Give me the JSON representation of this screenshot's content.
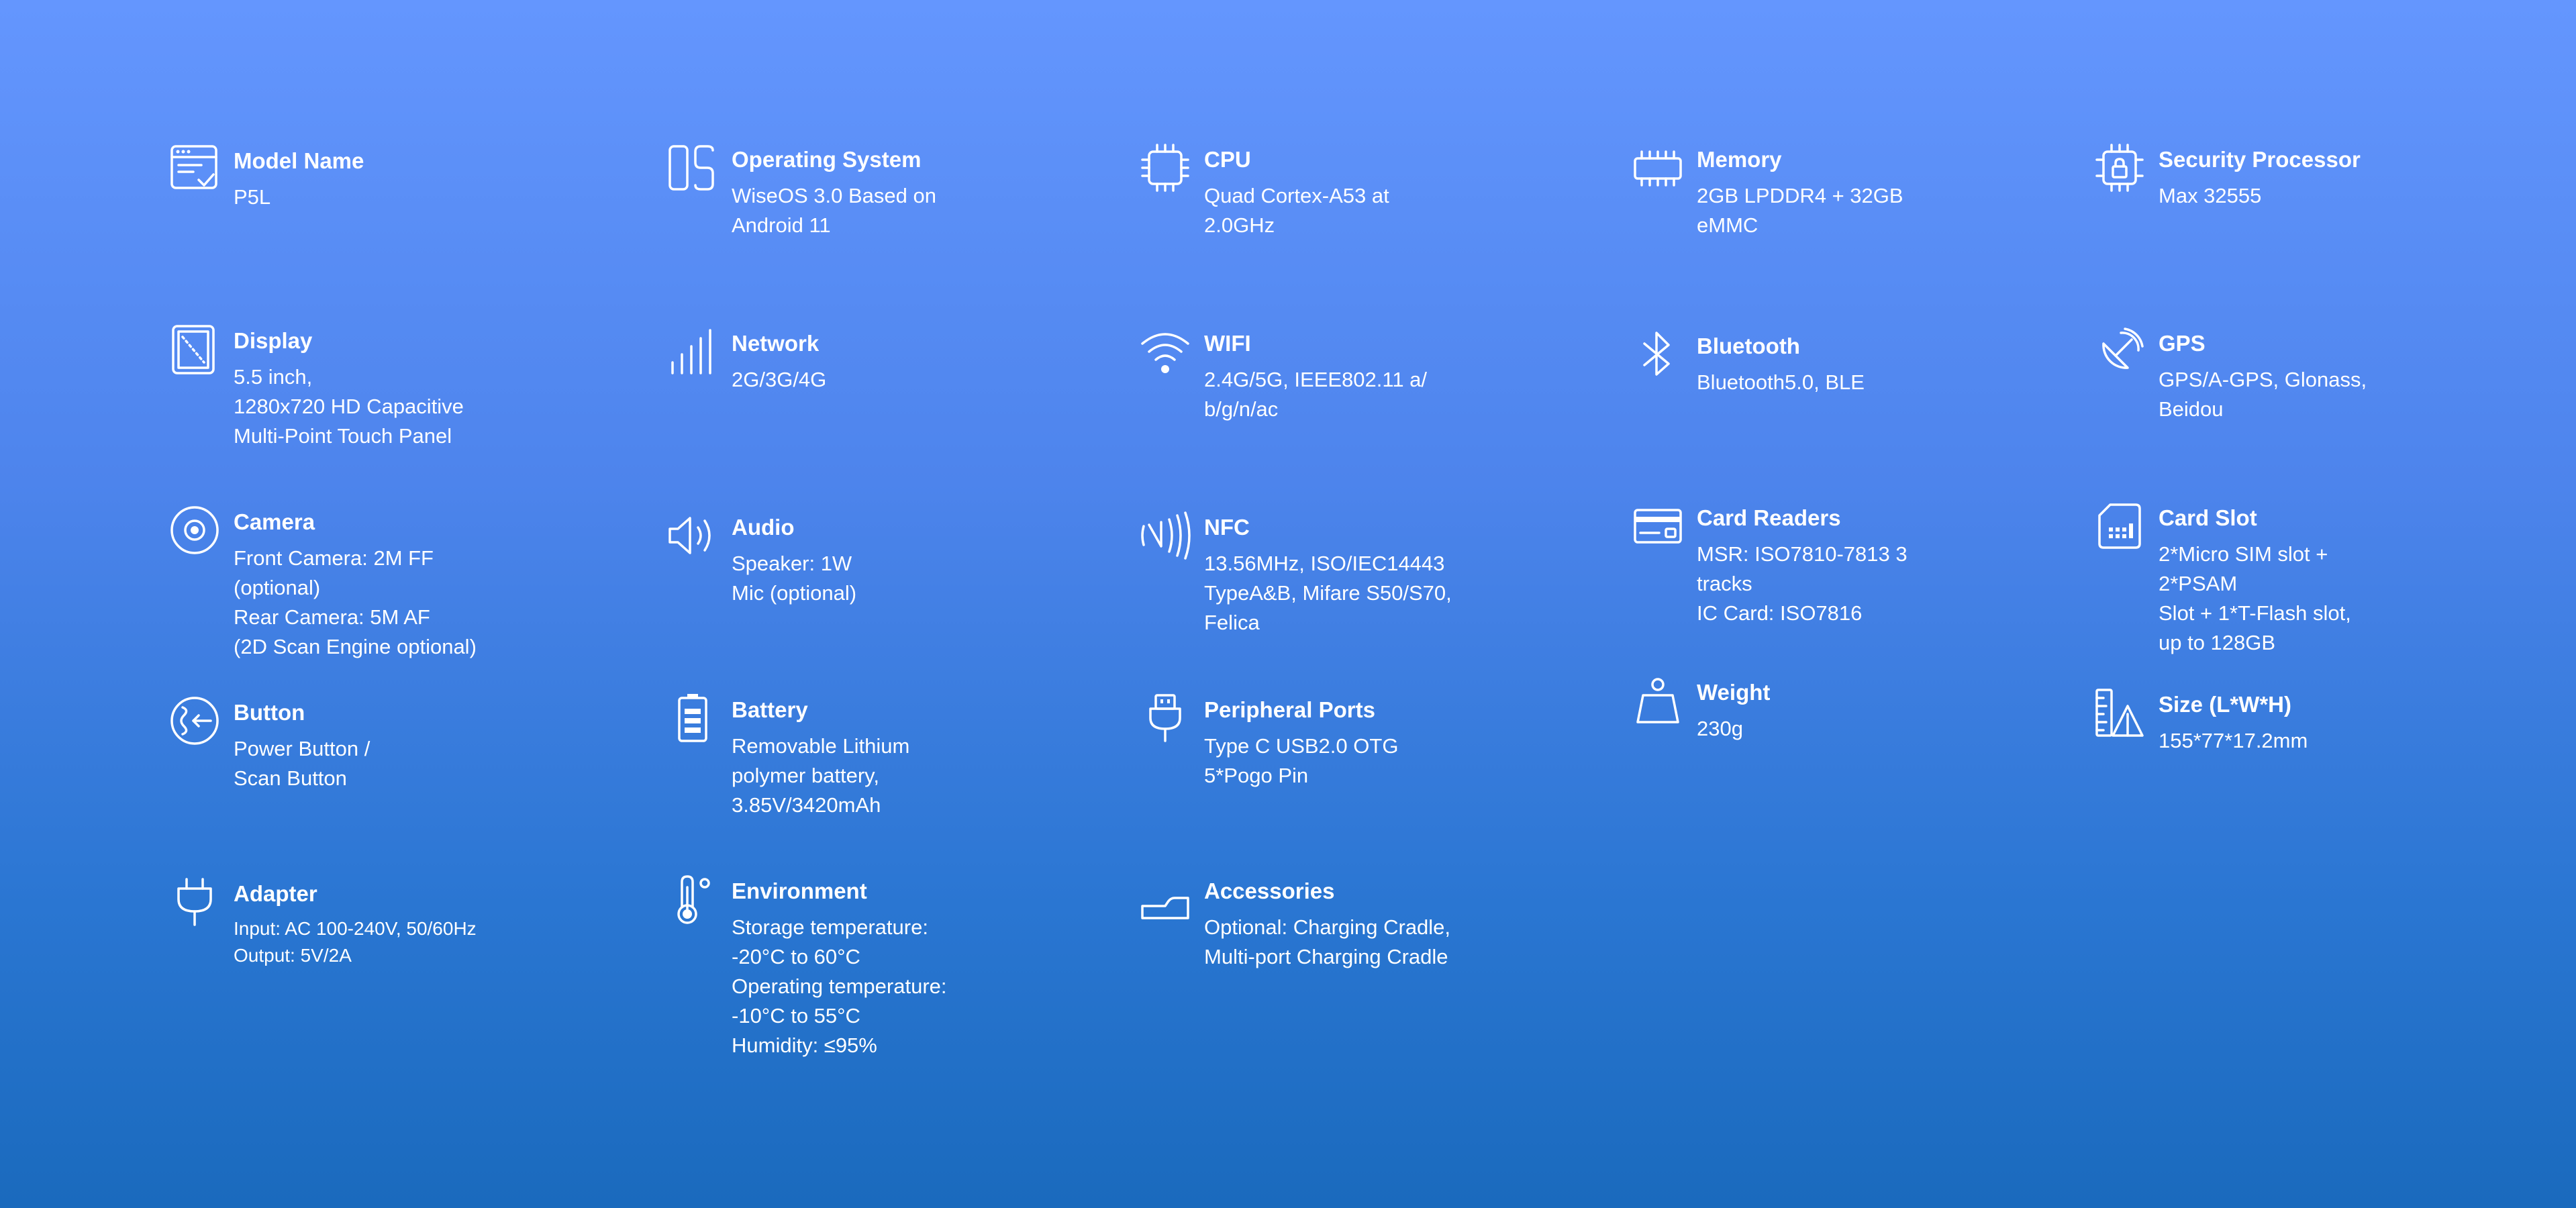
{
  "colors": {
    "background_top": "#6496fe",
    "background_bottom": "#1a6abd",
    "text": "#ffffff"
  },
  "specs": [
    {
      "icon": "window-check-icon",
      "label": "Model Name",
      "lines": [
        "P5L"
      ]
    },
    {
      "icon": "os-icon",
      "label": "Operating System",
      "lines": [
        "WiseOS 3.0 Based on",
        "Android 11"
      ]
    },
    {
      "icon": "cpu-chip-icon",
      "label": "CPU",
      "lines": [
        "Quad Cortex-A53 at",
        "2.0GHz"
      ]
    },
    {
      "icon": "memory-module-icon",
      "label": "Memory",
      "lines": [
        "2GB LPDDR4 + 32GB",
        "eMMC"
      ]
    },
    {
      "icon": "lock-chip-icon",
      "label": "Security Processor",
      "lines": [
        "Max 32555"
      ]
    },
    {
      "icon": "display-icon",
      "label": "Display",
      "lines": [
        "5.5 inch,",
        "1280x720 HD Capacitive",
        "Multi-Point Touch Panel"
      ]
    },
    {
      "icon": "signal-bars-icon",
      "label": "Network",
      "lines": [
        "2G/3G/4G"
      ]
    },
    {
      "icon": "wifi-icon",
      "label": "WIFI",
      "lines": [
        "2.4G/5G, IEEE802.11 a/",
        "b/g/n/ac"
      ]
    },
    {
      "icon": "bluetooth-icon",
      "label": "Bluetooth",
      "lines": [
        "Bluetooth5.0, BLE"
      ]
    },
    {
      "icon": "satellite-dish-icon",
      "label": "GPS",
      "lines": [
        "GPS/A-GPS, Glonass,",
        "Beidou"
      ]
    },
    {
      "icon": "camera-lens-icon",
      "label": "Camera",
      "lines": [
        "Front Camera: 2M FF",
        "(optional)",
        "Rear Camera: 5M AF",
        "(2D Scan Engine optional)"
      ]
    },
    {
      "icon": "speaker-icon",
      "label": "Audio",
      "lines": [
        "Speaker: 1W",
        "Mic (optional)"
      ]
    },
    {
      "icon": "nfc-icon",
      "label": "NFC",
      "lines": [
        "13.56MHz, ISO/IEC14443",
        "TypeA&B, Mifare S50/S70,",
        "Felica"
      ]
    },
    {
      "icon": "credit-card-icon",
      "label": "Card Readers",
      "lines": [
        "MSR: ISO7810-7813 3",
        "tracks",
        "IC Card: ISO7816"
      ]
    },
    {
      "icon": "sim-card-icon",
      "label": "Card Slot",
      "lines": [
        "2*Micro SIM slot +",
        "2*PSAM",
        "Slot + 1*T-Flash slot,",
        "up to 128GB"
      ]
    },
    {
      "icon": "power-button-icon",
      "label": "Button",
      "lines": [
        "Power Button /",
        "Scan Button"
      ]
    },
    {
      "icon": "battery-icon",
      "label": "Battery",
      "lines": [
        "Removable Lithium",
        "polymer battery,",
        "3.85V/3420mAh"
      ]
    },
    {
      "icon": "usb-plug-icon",
      "label": "Peripheral Ports",
      "lines": [
        "Type C USB2.0 OTG",
        "5*Pogo Pin"
      ]
    },
    {
      "icon": "weight-icon",
      "label": "Weight",
      "lines": [
        "230g"
      ]
    },
    {
      "icon": "ruler-triangle-icon",
      "label": "Size (L*W*H)",
      "lines": [
        "155*77*17.2mm"
      ]
    },
    {
      "icon": "power-plug-icon",
      "label": "Adapter",
      "lines": [
        "Input: AC 100-240V, 50/60Hz",
        "Output: 5V/2A"
      ]
    },
    {
      "icon": "thermometer-icon",
      "label": "Environment",
      "lines": [
        "Storage temperature:",
        "-20°C to 60°C",
        "Operating temperature:",
        "-10°C to 55°C",
        "Humidity: ≤95%"
      ]
    },
    {
      "icon": "cradle-icon",
      "label": "Accessories",
      "lines": [
        "Optional: Charging Cradle,",
        "Multi-port Charging Cradle"
      ]
    }
  ]
}
